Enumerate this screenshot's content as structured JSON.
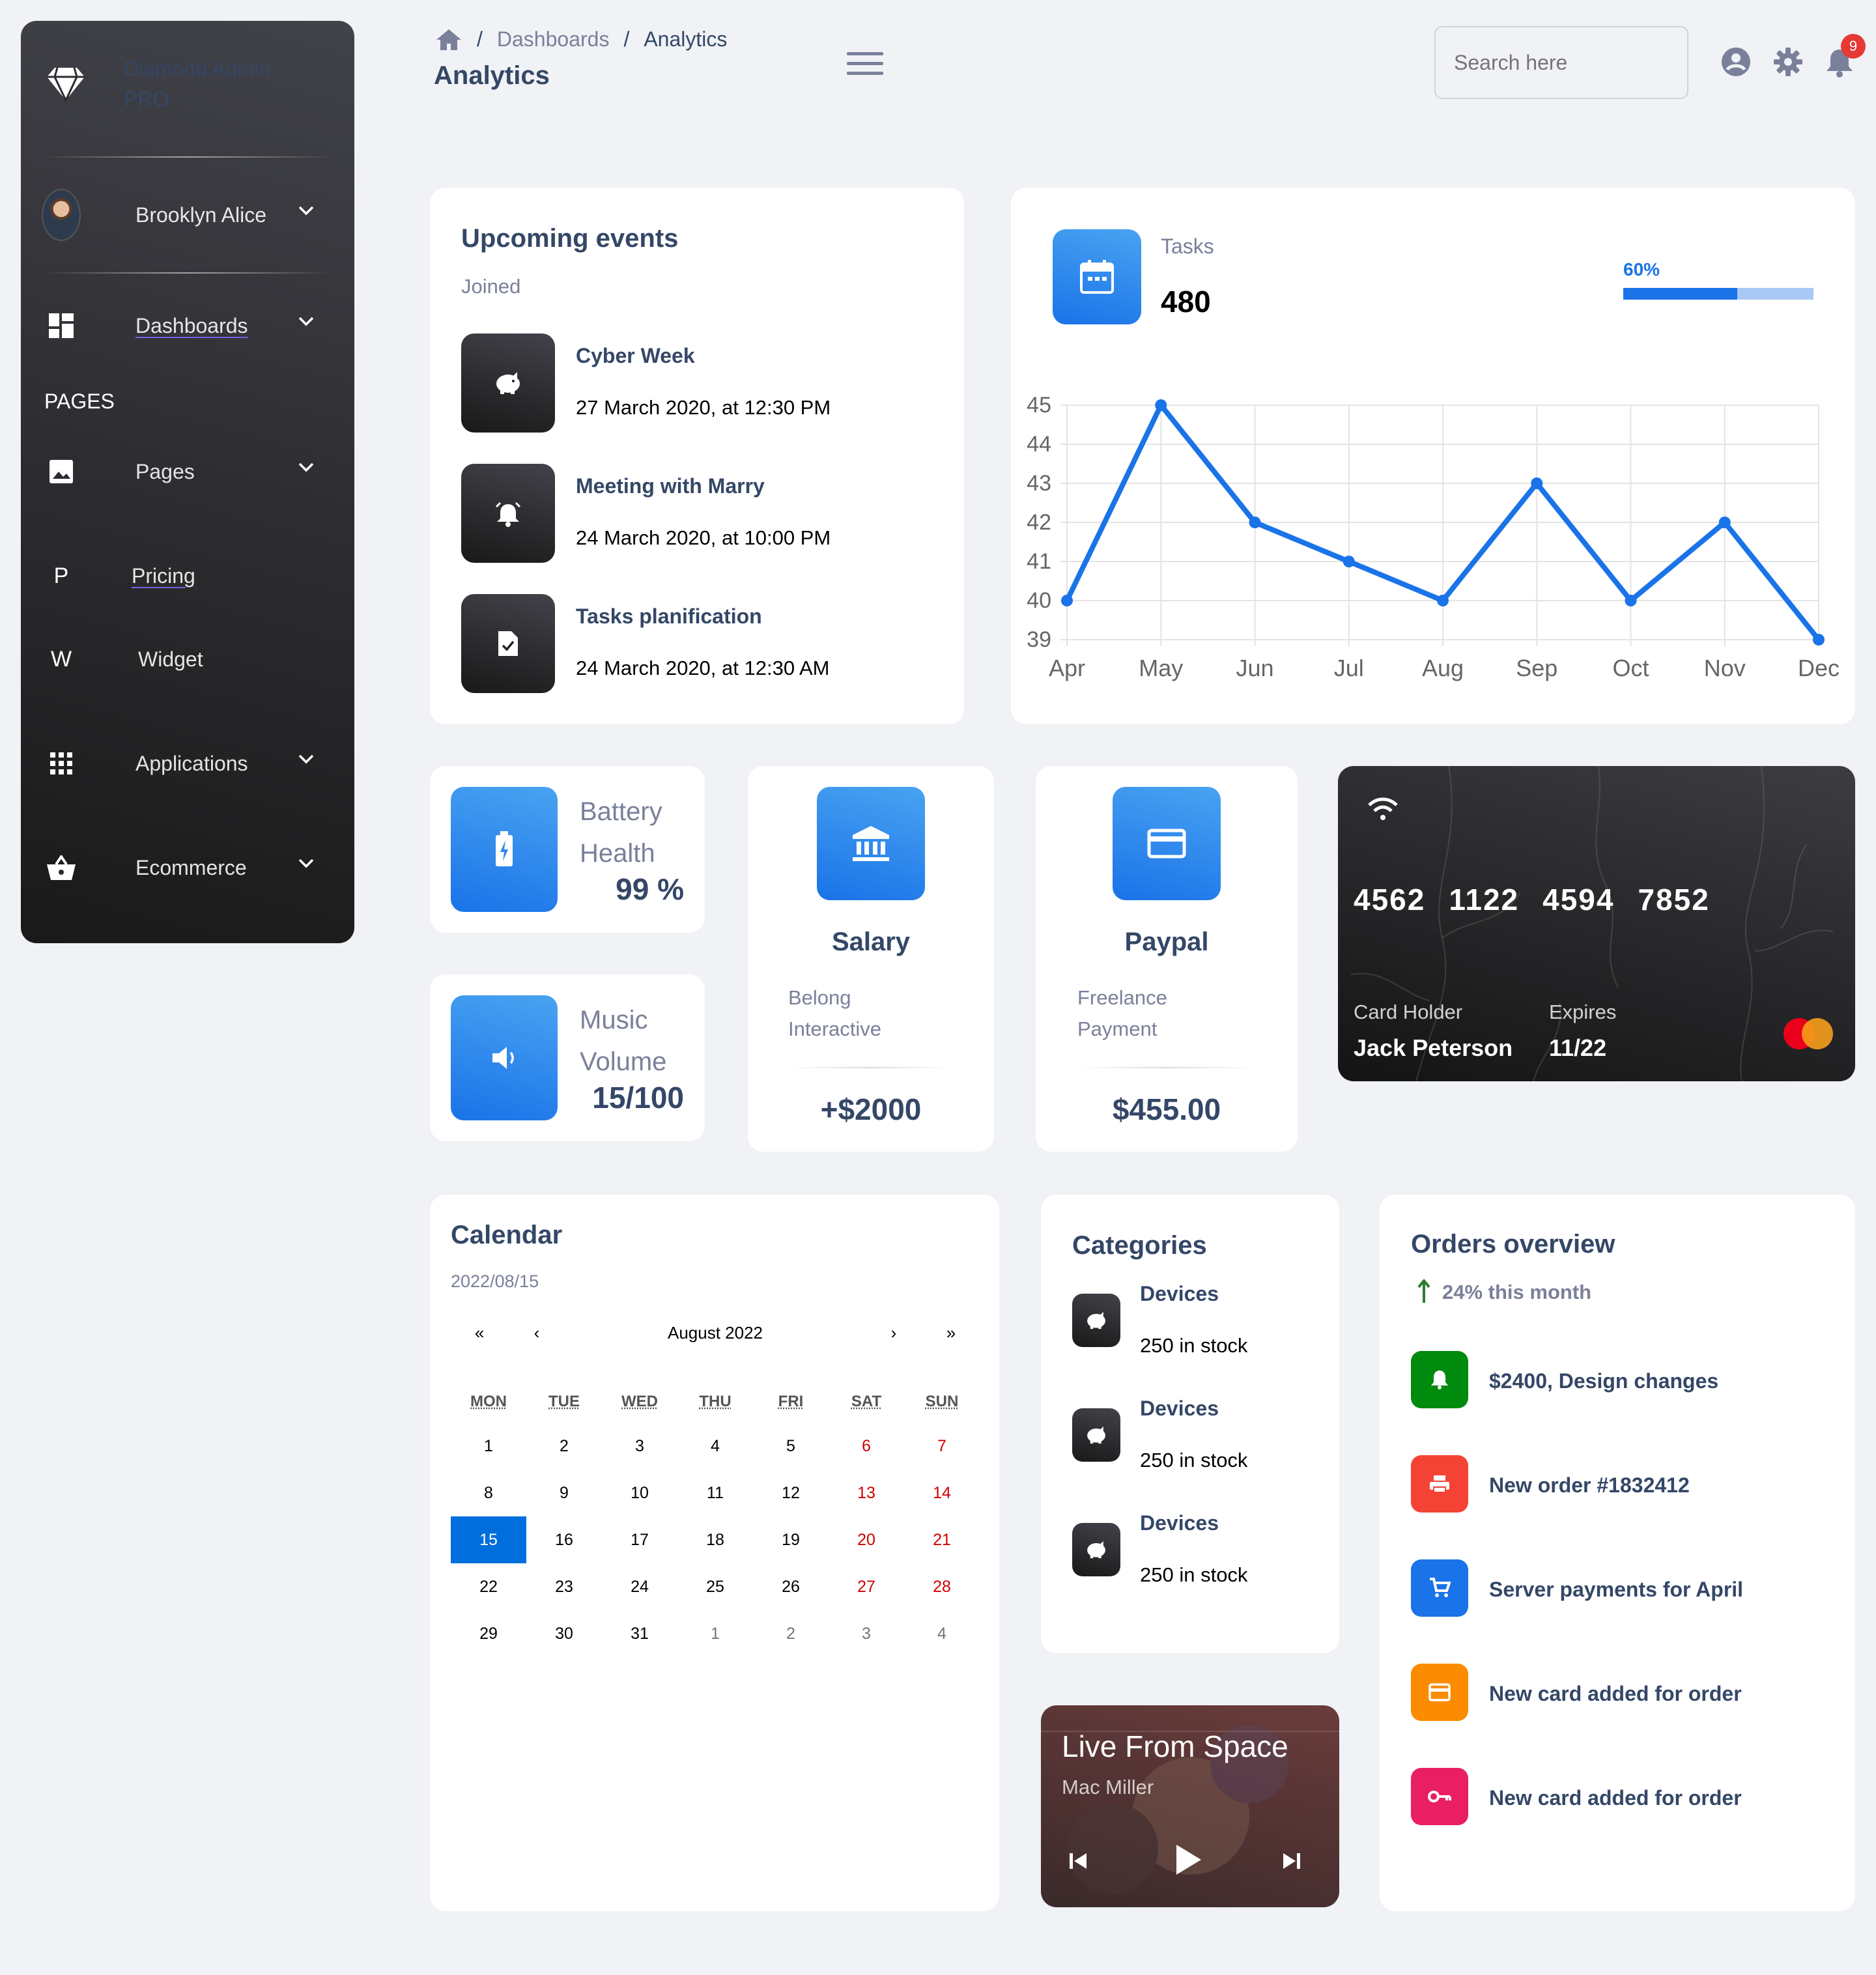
{
  "sidebar": {
    "brand": "Diamond Admin PRO",
    "user": "Brooklyn Alice",
    "items": [
      {
        "label": "Dashboards",
        "icon": "dashboard-icon"
      },
      {
        "label": "Pages",
        "icon": "image-icon"
      },
      {
        "label": "Pricing",
        "icon_letter": "P"
      },
      {
        "label": "Widget",
        "icon_letter": "W"
      },
      {
        "label": "Applications",
        "icon": "apps-icon"
      },
      {
        "label": "Ecommerce",
        "icon": "basket-icon"
      }
    ],
    "section_label": "PAGES"
  },
  "header": {
    "breadcrumb": [
      "Dashboards",
      "Analytics"
    ],
    "title": "Analytics",
    "search_placeholder": "Search here",
    "notification_count": "9"
  },
  "events": {
    "title": "Upcoming events",
    "subtitle": "Joined",
    "items": [
      {
        "title": "Cyber Week",
        "date": "27 March 2020, at 12:30 PM",
        "icon": "piggy-bank-icon"
      },
      {
        "title": "Meeting with Marry",
        "date": "24 March 2020, at 10:00 PM",
        "icon": "alarm-icon"
      },
      {
        "title": "Tasks planification",
        "date": "24 March 2020, at 12:30 AM",
        "icon": "task-file-icon"
      }
    ]
  },
  "tasks": {
    "label": "Tasks",
    "value": "480",
    "progress_label": "60%",
    "progress": 0.6
  },
  "chart_data": {
    "type": "line",
    "categories": [
      "Apr",
      "May",
      "Jun",
      "Jul",
      "Aug",
      "Sep",
      "Oct",
      "Nov",
      "Dec"
    ],
    "values": [
      40,
      45,
      42,
      41,
      40,
      43,
      40,
      42,
      39
    ],
    "ylim": [
      39,
      45
    ],
    "yticks": [
      "45",
      "44",
      "43",
      "42",
      "41",
      "40",
      "39"
    ],
    "color": "#1A73E8",
    "grid": true
  },
  "battery": {
    "label1": "Battery",
    "label2": "Health",
    "value": "99 %"
  },
  "music": {
    "label1": "Music",
    "label2": "Volume",
    "value": "15/100"
  },
  "salary": {
    "title": "Salary",
    "line1": "Belong",
    "line2": "Interactive",
    "value": "+$2000"
  },
  "paypal": {
    "title": "Paypal",
    "line1": "Freelance",
    "line2": "Payment",
    "value": "$455.00"
  },
  "credit_card": {
    "number": [
      "4562",
      "1122",
      "4594",
      "7852"
    ],
    "holder_label": "Card Holder",
    "holder": "Jack Peterson",
    "expires_label": "Expires",
    "expires": "11/22"
  },
  "calendar": {
    "title": "Calendar",
    "date": "2022/08/15",
    "month": "August 2022",
    "nav": [
      "«",
      "‹",
      "›",
      "»"
    ],
    "weekdays": [
      "MON",
      "TUE",
      "WED",
      "THU",
      "FRI",
      "SAT",
      "SUN"
    ],
    "weeks": [
      [
        "1",
        "2",
        "3",
        "4",
        "5",
        "6",
        "7"
      ],
      [
        "8",
        "9",
        "10",
        "11",
        "12",
        "13",
        "14"
      ],
      [
        "15",
        "16",
        "17",
        "18",
        "19",
        "20",
        "21"
      ],
      [
        "22",
        "23",
        "24",
        "25",
        "26",
        "27",
        "28"
      ],
      [
        "29",
        "30",
        "31",
        "1",
        "2",
        "3",
        "4"
      ]
    ],
    "selected": "15"
  },
  "categories": {
    "title": "Categories",
    "items": [
      {
        "name": "Devices",
        "stock": "250 in stock"
      },
      {
        "name": "Devices",
        "stock": "250 in stock"
      },
      {
        "name": "Devices",
        "stock": "250 in stock"
      }
    ]
  },
  "player": {
    "title": "Live From Space",
    "artist": "Mac Miller"
  },
  "orders": {
    "title": "Orders overview",
    "growth": "24% this month",
    "items": [
      {
        "label": "$2400, Design changes",
        "color": "#008a0e",
        "icon": "bell-icon"
      },
      {
        "label": "New order #1832412",
        "color": "#F44335",
        "icon": "printer-icon"
      },
      {
        "label": "Server payments for April",
        "color": "#1A73E8",
        "icon": "cart-icon"
      },
      {
        "label": "New card added for order",
        "color": "#fb8c00",
        "icon": "card-icon"
      },
      {
        "label": "New card added for order",
        "color": "#e91e63",
        "icon": "key-icon"
      }
    ]
  }
}
